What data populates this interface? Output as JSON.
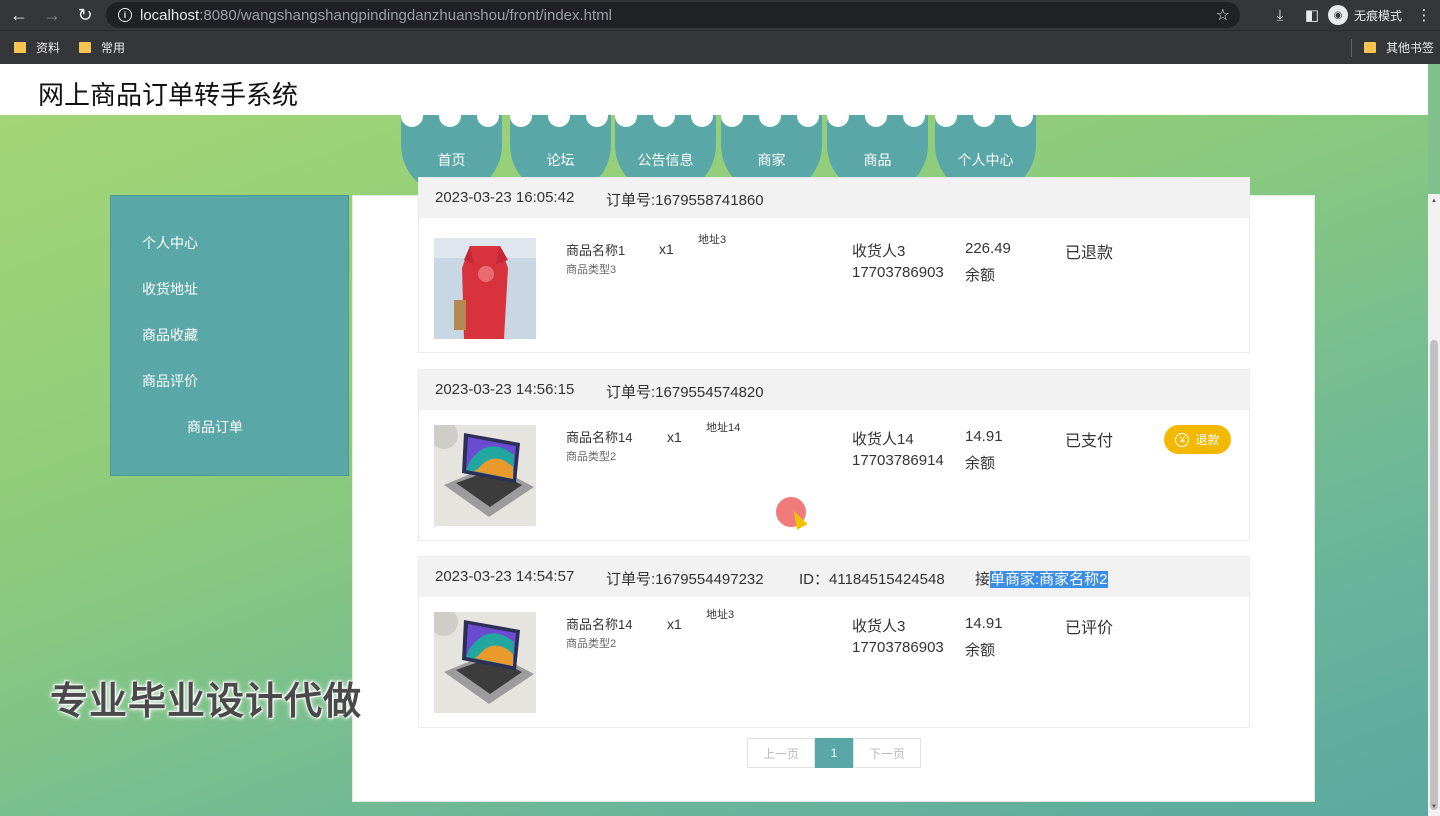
{
  "browser": {
    "url_host": "localhost",
    "url_rest": ":8080/wangshangshangpindingdanzhuanshou/front/index.html",
    "incognito_label": "无痕模式",
    "bookmarks": [
      "资料",
      "常用"
    ],
    "other_bookmarks": "其他书签"
  },
  "site": {
    "title": "网上商品订单转手系统"
  },
  "menu": [
    "首页",
    "论坛",
    "公告信息",
    "商家",
    "商品",
    "个人中心"
  ],
  "sidebar": [
    "个人中心",
    "收货地址",
    "商品收藏",
    "商品评价",
    "商品订单"
  ],
  "orders": [
    {
      "time": "2023-03-23 16:05:42",
      "order_no": "订单号:1679558741860",
      "name": "商品名称1",
      "type": "商品类型3",
      "qty": "x1",
      "address": "地址3",
      "receiver": "收货人3",
      "phone": "17703786903",
      "price": "226.49",
      "pay": "余额",
      "status": "已退款"
    },
    {
      "time": "2023-03-23 14:56:15",
      "order_no": "订单号:1679554574820",
      "name": "商品名称14",
      "type": "商品类型2",
      "qty": "x1",
      "address": "地址14",
      "receiver": "收货人14",
      "phone": "17703786914",
      "price": "14.91",
      "pay": "余额",
      "status": "已支付",
      "refund_label": "退款"
    },
    {
      "time": "2023-03-23 14:54:57",
      "order_no": "订单号:1679554497232",
      "id_text": "ID：41184515424548",
      "merchant_prefix": "接",
      "merchant_sel": "单商家:商家名称2",
      "name": "商品名称14",
      "type": "商品类型2",
      "qty": "x1",
      "address": "地址3",
      "receiver": "收货人3",
      "phone": "17703786903",
      "price": "14.91",
      "pay": "余额",
      "status": "已评价"
    }
  ],
  "pager": {
    "prev": "上一页",
    "current": "1",
    "next": "下一页"
  },
  "watermark": "专业毕业设计代做",
  "colors": {
    "teal": "#5aa7a8",
    "refund": "#f5b800",
    "selection": "#3a8ee6"
  }
}
